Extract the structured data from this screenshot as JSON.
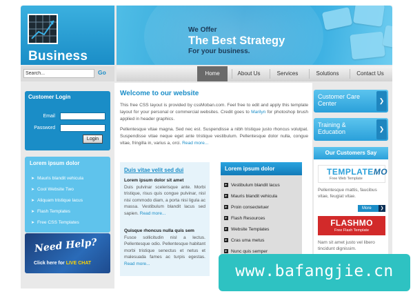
{
  "header": {
    "logo_text": "Business",
    "banner_kicker": "We Offer",
    "banner_title": "The Best Strategy",
    "banner_subtitle": "For your business."
  },
  "search": {
    "placeholder": "Search...",
    "value": "Search...",
    "button_label": "Go"
  },
  "nav": {
    "items": [
      {
        "label": "Home",
        "active": true
      },
      {
        "label": "About Us"
      },
      {
        "label": "Services"
      },
      {
        "label": "Solutions"
      },
      {
        "label": "Contact Us"
      }
    ]
  },
  "login": {
    "title": "Customer Login",
    "email_label": "Email",
    "password_label": "Password",
    "button_label": "Login"
  },
  "left_list": {
    "title": "Lorem ipsum dolor",
    "items": [
      "Mauris blandit vehicula",
      "Cool Website Two",
      "Aliquam tristique lacus",
      "Flash Templates",
      "Free CSS Templates"
    ]
  },
  "help": {
    "title": "Need Help?",
    "cta_prefix": "Click here for",
    "cta_highlight": "LIVE CHAT"
  },
  "main": {
    "welcome_title": "Welcome to our website",
    "para1_a": "This free CSS layout is provided by cssMoban.com. Feel free to edit and apply this template layout for your personal or commercial websites. Credit goes to",
    "para1_link": "Marilyn",
    "para1_b": "for photoshop brush applied in header graphics.",
    "para2": "Pellentesque vitae magna. Sed nec est. Suspendisse a nibh tristique justo rhoncus volutpat. Suspendisse vitae neque eget ante tristique vestibulum. Pellentesque dolor nulla, congue vitae, fringilla in, varius a, orci.",
    "para2_more": "Read more..."
  },
  "news": {
    "title": "Duis vitae velit sed dui",
    "item1_title": "Lorem ipsum dolor sit amet",
    "item1_body": "Duis pulvinar scelerisque ante. Morbi tristique, risus quis congue pulvinar, nisl nisi commodo diam, a porta nisi ligula ac massa. Vestibulum blandit lacus sed sapien.",
    "item1_more": "Read more...",
    "item2_title": "Quisque rhoncus nulla quis sem",
    "item2_body": "Fusce sollicitudin nisl a lectus. Pellentesque odio. Pellentesque habitant morbi tristique senectus et netus et malesuada fames ac turpis egestas.",
    "item2_more": "Read more..."
  },
  "list2": {
    "title": "Lorem ipsum dolor",
    "items": [
      "Vestibulum blandit lacus",
      "Mauris blandit vehicula",
      "Proin consectetuer",
      "Flash Resources",
      "Website Templates",
      "Cras uma metus",
      "Nunc quis semper"
    ]
  },
  "right": {
    "button1": "Customer Care Center",
    "button1_line1": "Customer Care",
    "button1_line2": "Center",
    "button2_line1": "Training &",
    "button2_line2": "Education",
    "customers_title": "Our Customers Say",
    "tm_logo_main": "TEMPLATE",
    "tm_logo_mo": "MO",
    "tm_logo_sub": "Free Web Template",
    "customer1_text": "Pellentesque mattis, faucibus vitae, feugiat vitae.",
    "more_label": "More",
    "fm_logo_main": "FLASHMO",
    "fm_logo_sub": "Free Flash Template",
    "customer2_text": "Nam sit amet justo vel libero tincidunt dignissim."
  },
  "watermark": {
    "text": "www.bafangjie.cn"
  },
  "colors": {
    "accent": "#1a8dc7",
    "nav_active": "#6a6a6a",
    "flashmo_red": "#d22a2a",
    "watermark": "#2ec2c2"
  }
}
